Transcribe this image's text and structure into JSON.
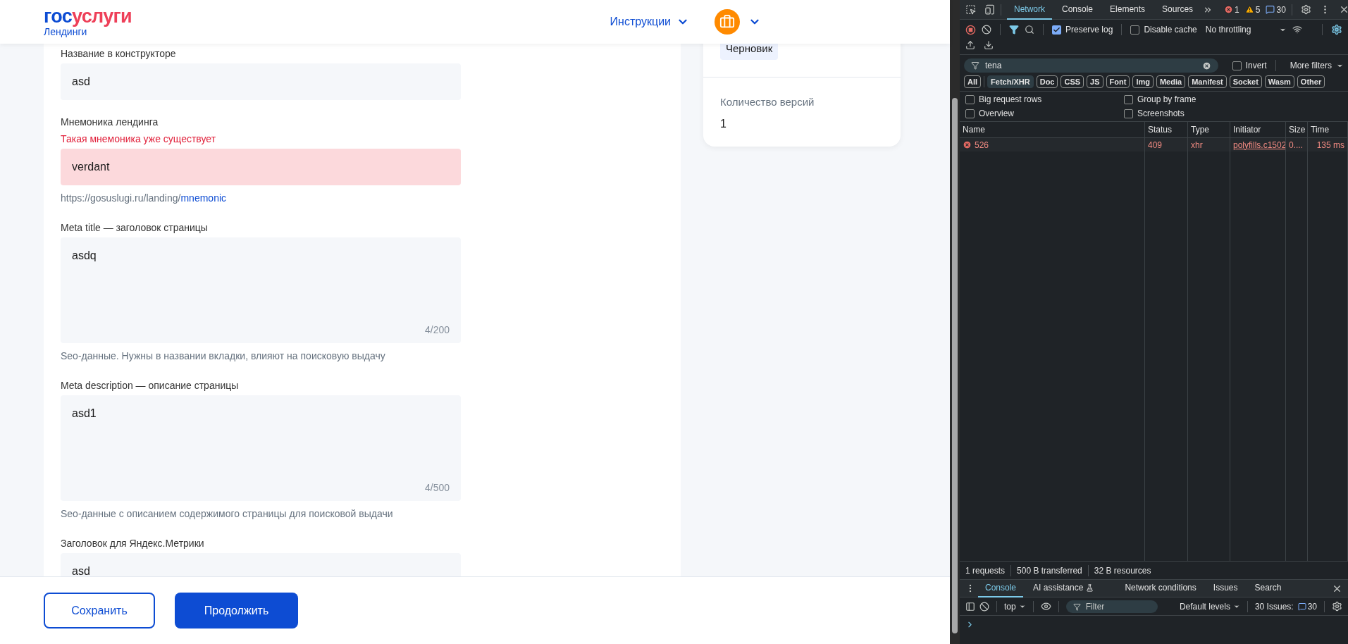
{
  "header": {
    "logo": [
      {
        "text": "гос",
        "color": "#0d4cd3"
      },
      {
        "text": "услуги",
        "color": "#ee3f58"
      }
    ],
    "subtitle": "Лендинги",
    "menu": "Инструкции"
  },
  "form": {
    "fields": [
      {
        "kind": "input",
        "label": "Название в конструкторе",
        "value": "asd"
      },
      {
        "kind": "input",
        "label": "Мнемоника лендинга",
        "error": "Такая мнемоника уже существует",
        "value": "verdant",
        "invalid": true,
        "hint_prefix": "https://gosuslugi.ru/landing/",
        "hint_link": "mnemonic"
      },
      {
        "kind": "textarea",
        "label": "Meta title — заголовок страницы",
        "value": "asdq",
        "counter": "4/200",
        "hint": "Seo-данные. Нужны в названии вкладки, влияют на поисковую выдачу"
      },
      {
        "kind": "textarea",
        "label": "Meta description — описание страницы",
        "value": "asd1",
        "counter": "4/500",
        "hint": "Seo-данные с описанием содержимого страницы для поисковой выдачи"
      },
      {
        "kind": "input",
        "label": "Заголовок для Яндекс.Метрики",
        "value": "asd"
      }
    ]
  },
  "info_card": {
    "status": "Черновик",
    "versions_label": "Количество версий",
    "versions": "1"
  },
  "buttons": [
    {
      "label": "Сохранить",
      "kind": "secondary"
    },
    {
      "label": "Продолжить",
      "kind": "primary"
    }
  ],
  "devtools": {
    "tabs": [
      {
        "label": "Network",
        "selected": true
      },
      {
        "label": "Console",
        "selected": false
      },
      {
        "label": "Elements",
        "selected": false
      },
      {
        "label": "Sources",
        "selected": false
      }
    ],
    "counts": [
      {
        "kind": "error",
        "text": "1"
      },
      {
        "kind": "warning",
        "text": "5"
      },
      {
        "kind": "info",
        "text": "30"
      }
    ],
    "preserve_log": {
      "label": "Preserve log",
      "checked": true
    },
    "disable_cache": {
      "label": "Disable cache",
      "checked": false
    },
    "throttling": "No throttling",
    "filter": {
      "value": "tena",
      "invert": {
        "label": "Invert",
        "checked": false
      },
      "more_filters": "More filters"
    },
    "type_filters": [
      {
        "label": "All",
        "selected": false
      },
      {
        "label": "Fetch/XHR",
        "selected": true
      },
      {
        "label": "Doc",
        "selected": false
      },
      {
        "label": "CSS",
        "selected": false
      },
      {
        "label": "JS",
        "selected": false
      },
      {
        "label": "Font",
        "selected": false
      },
      {
        "label": "Img",
        "selected": false
      },
      {
        "label": "Media",
        "selected": false
      },
      {
        "label": "Manifest",
        "selected": false
      },
      {
        "label": "Socket",
        "selected": false
      },
      {
        "label": "Wasm",
        "selected": false
      },
      {
        "label": "Other",
        "selected": false
      }
    ],
    "options": [
      {
        "label": "Big request rows",
        "checked": false
      },
      {
        "label": "Group by frame",
        "checked": false
      },
      {
        "label": "Overview",
        "checked": false
      },
      {
        "label": "Screenshots",
        "checked": false
      }
    ],
    "table": {
      "columns": [
        "Name",
        "Status",
        "Type",
        "Initiator",
        "Size",
        "Time"
      ],
      "rows": [
        {
          "failed": true,
          "cells": [
            "526",
            "409",
            "xhr",
            "polyfills.c1502",
            "0....",
            "135 ms"
          ]
        }
      ]
    },
    "summary": [
      "1 requests",
      "500 B transferred",
      "32 B resources"
    ],
    "drawer": {
      "tabs": [
        {
          "label": "Console",
          "selected": true
        },
        {
          "label": "AI assistance",
          "selected": false
        },
        {
          "label": "Network conditions",
          "selected": false
        },
        {
          "label": "Issues",
          "selected": false
        },
        {
          "label": "Search",
          "selected": false
        }
      ],
      "context": "top",
      "filter_placeholder": "Filter",
      "levels": "Default levels",
      "issues_label": "30 Issues:",
      "issues_count": "30"
    }
  }
}
